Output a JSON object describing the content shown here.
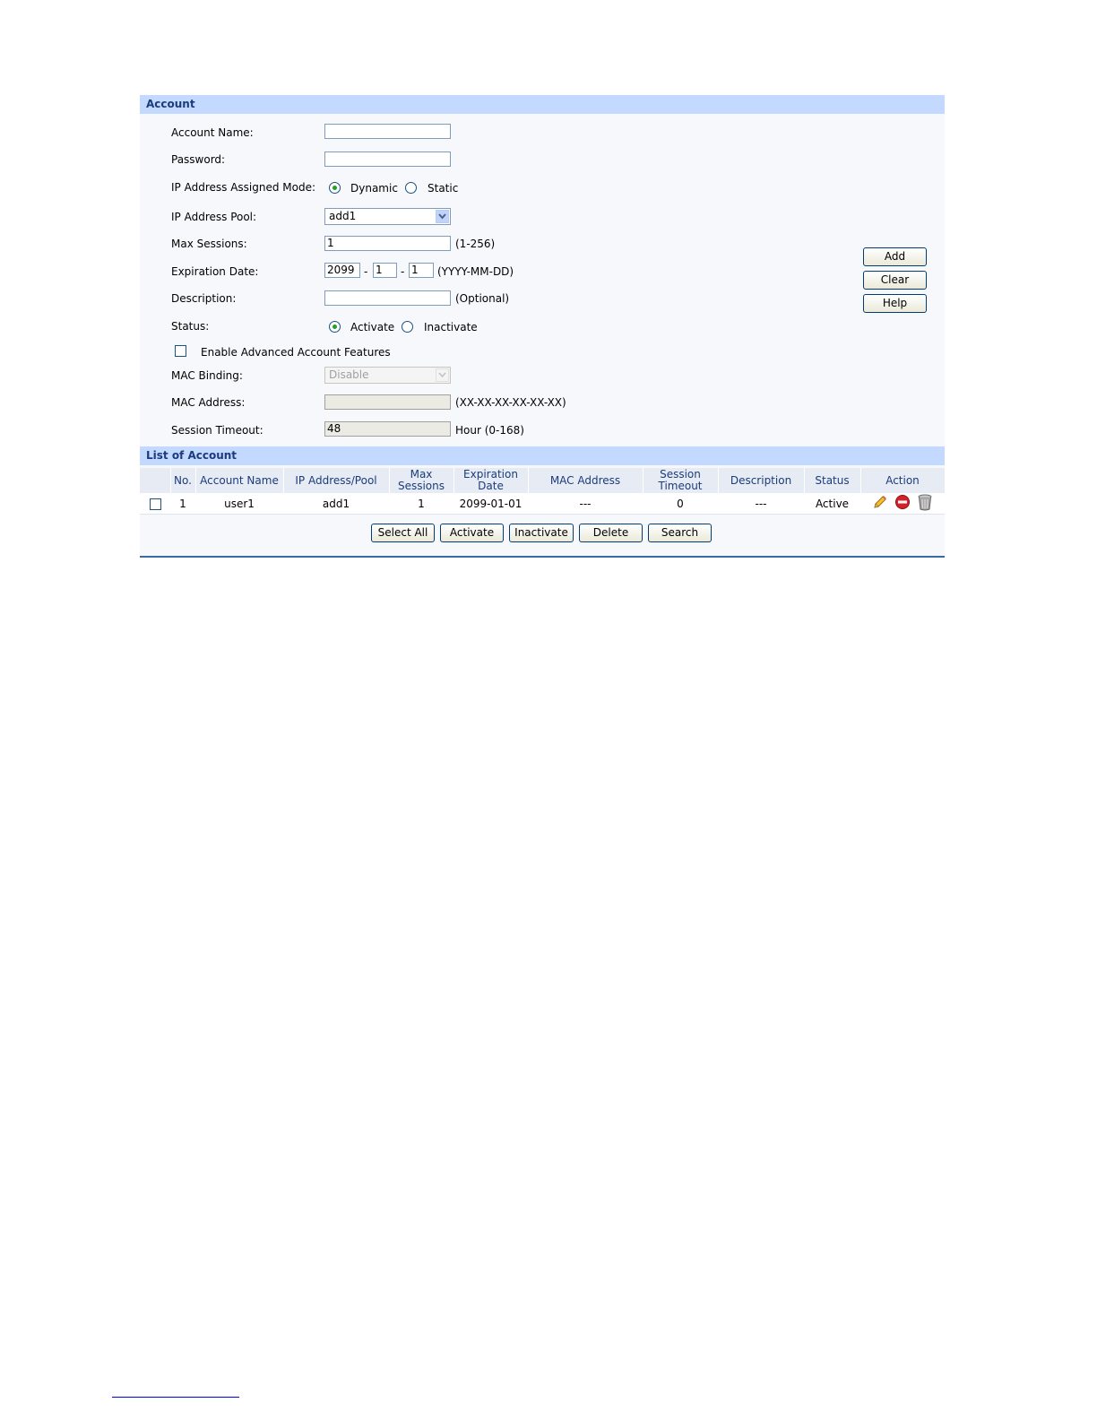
{
  "account_section": {
    "title": "Account",
    "account_name_label": "Account Name:",
    "account_name_value": "",
    "password_label": "Password:",
    "password_value": "",
    "ip_mode_label": "IP Address Assigned Mode:",
    "ip_mode_dynamic": "Dynamic",
    "ip_mode_static": "Static",
    "ip_mode_selected": "Dynamic",
    "ip_pool_label": "IP Address Pool:",
    "ip_pool_value": "add1",
    "max_sessions_label": "Max Sessions:",
    "max_sessions_value": "1",
    "max_sessions_hint": "(1-256)",
    "expiration_label": "Expiration Date:",
    "expiration_year": "2099",
    "expiration_month": "1",
    "expiration_day": "1",
    "date_separator": "-",
    "expiration_hint": "(YYYY-MM-DD)",
    "description_label": "Description:",
    "description_value": "",
    "description_hint": "(Optional)",
    "status_label": "Status:",
    "status_activate": "Activate",
    "status_inactivate": "Inactivate",
    "status_selected": "Activate",
    "advanced_label": "Enable Advanced Account Features",
    "advanced_checked": false,
    "mac_binding_label": "MAC Binding:",
    "mac_binding_value": "Disable",
    "mac_address_label": "MAC Address:",
    "mac_address_value": "",
    "mac_address_hint": "(XX-XX-XX-XX-XX-XX)",
    "session_timeout_label": "Session Timeout:",
    "session_timeout_value": "48",
    "session_timeout_hint": "Hour (0-168)"
  },
  "side_buttons": {
    "add": "Add",
    "clear": "Clear",
    "help": "Help"
  },
  "list_section": {
    "title": "List of Account",
    "columns": {
      "no": "No.",
      "account_name": "Account Name",
      "ip_pool": "IP Address/Pool",
      "max_sessions_1": "Max",
      "max_sessions_2": "Sessions",
      "expiration_1": "Expiration",
      "expiration_2": "Date",
      "mac": "MAC Address",
      "timeout_1": "Session",
      "timeout_2": "Timeout",
      "description": "Description",
      "status": "Status",
      "action": "Action"
    },
    "rows": [
      {
        "no": "1",
        "account_name": "user1",
        "ip_pool": "add1",
        "max_sessions": "1",
        "expiration": "2099-01-01",
        "mac": "---",
        "timeout": "0",
        "description": "---",
        "status": "Active",
        "actions": [
          "edit-icon",
          "disable-icon",
          "trash-icon"
        ]
      }
    ]
  },
  "bottom_buttons": {
    "select_all": "Select All",
    "activate": "Activate",
    "inactivate": "Inactivate",
    "delete": "Delete",
    "search": "Search"
  },
  "colors": {
    "header_bg": "#c3d9ff",
    "header_text": "#1b3c7c",
    "panel_bg": "#f7f8fb",
    "radio_dot": "#21a121"
  }
}
